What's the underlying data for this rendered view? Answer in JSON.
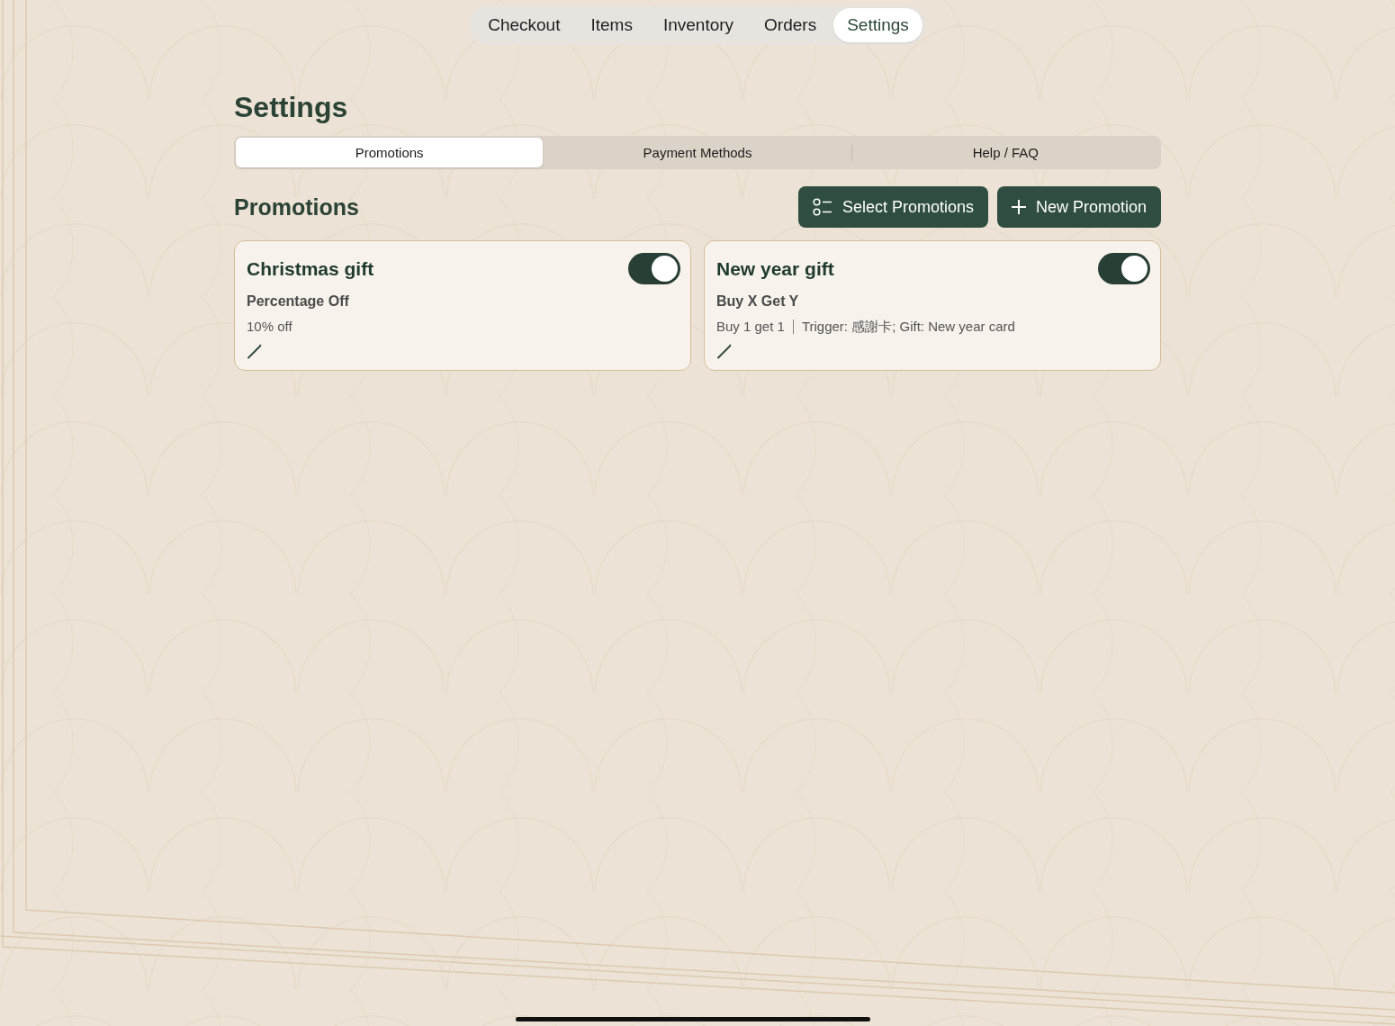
{
  "nav_tabs": [
    {
      "label": "Checkout",
      "selected": false
    },
    {
      "label": "Items",
      "selected": false
    },
    {
      "label": "Inventory",
      "selected": false
    },
    {
      "label": "Orders",
      "selected": false
    },
    {
      "label": "Settings",
      "selected": true
    }
  ],
  "page_title": "Settings",
  "segments": [
    {
      "label": "Promotions",
      "selected": true
    },
    {
      "label": "Payment Methods",
      "selected": false
    },
    {
      "label": "Help / FAQ",
      "selected": false
    }
  ],
  "section": {
    "title": "Promotions",
    "buttons": [
      {
        "kind": "select",
        "label": "Select Promotions"
      },
      {
        "kind": "new",
        "label": "New Promotion"
      }
    ]
  },
  "promotions": [
    {
      "name": "Christmas gift",
      "on": true,
      "type": "Percentage Off",
      "details": [
        "10% off"
      ]
    },
    {
      "name": "New year gift",
      "on": true,
      "type": "Buy X Get Y",
      "details": [
        "Buy 1 get 1",
        "Trigger: 感謝卡; Gift: New year card"
      ]
    }
  ]
}
